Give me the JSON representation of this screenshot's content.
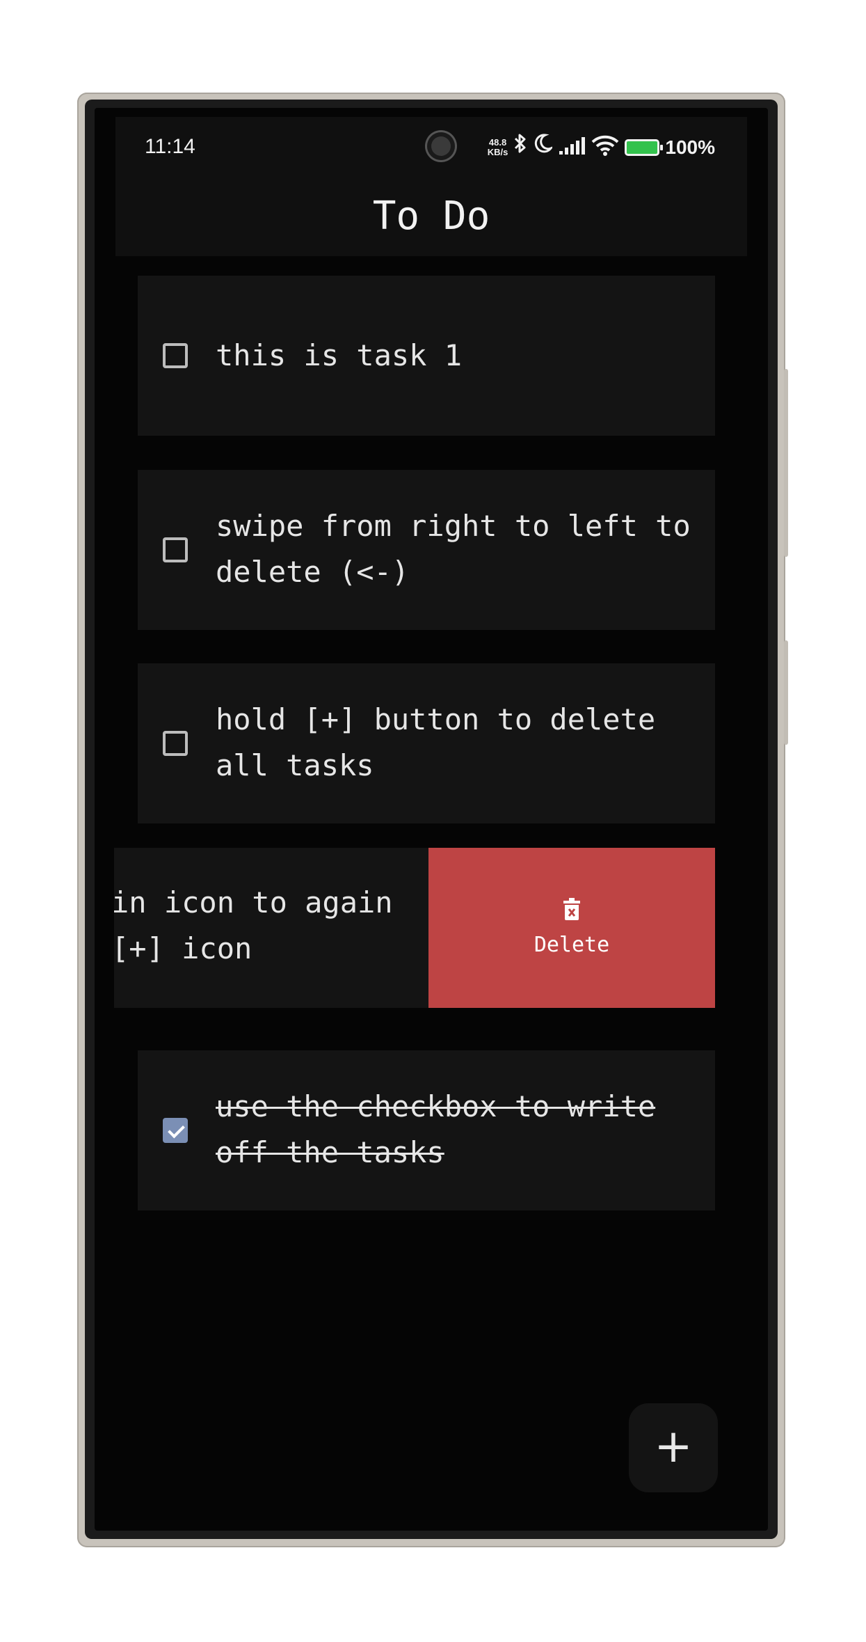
{
  "status_bar": {
    "time": "11:14",
    "net_speed_value": "48.8",
    "net_speed_unit": "KB/s",
    "bluetooth_icon": "bluetooth-icon",
    "dnd_icon": "moon-icon",
    "signal_icon": "signal-icon",
    "wifi_icon": "wifi-icon",
    "battery_icon": "battery-charging-icon",
    "battery_percent": "100%",
    "battery_color": "#33c24d"
  },
  "app_bar": {
    "title": "To Do"
  },
  "tasks": [
    {
      "text": "this is task 1",
      "done": false
    },
    {
      "text": "swipe from right to left to\ndelete (<-)",
      "done": false
    },
    {
      "text": "hold [+] button to delete\nall tasks",
      "done": false
    },
    {
      "text": "in icon to again\n[+] icon",
      "done": false,
      "swiped": true
    },
    {
      "text": "use the checkbox to write\noff the tasks",
      "done": true
    }
  ],
  "swipe_action": {
    "label": "Delete",
    "icon": "trash-icon",
    "color": "#be4444"
  },
  "fab": {
    "label": "+",
    "icon": "plus-icon"
  },
  "colors": {
    "background": "#050505",
    "card": "#141414",
    "checkbox_checked": "#7b8fb5"
  }
}
